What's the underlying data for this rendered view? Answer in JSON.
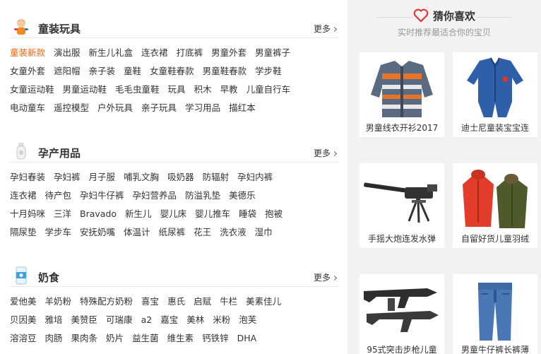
{
  "sections": [
    {
      "title": "童装玩具",
      "more": "更多",
      "rows": [
        [
          "童装新款",
          "演出服",
          "新生儿礼盒",
          "连衣裙",
          "打底裤",
          "男童外套",
          "男童裤子"
        ],
        [
          "女童外套",
          "遮阳帽",
          "亲子装",
          "童鞋",
          "女童鞋春款",
          "男童鞋春款",
          "学步鞋"
        ],
        [
          "女童运动鞋",
          "男童运动鞋",
          "毛毛虫童鞋",
          "玩具",
          "积木",
          "早教",
          "儿童自行车"
        ],
        [
          "电动童车",
          "遥控模型",
          "户外玩具",
          "亲子玩具",
          "学习用品",
          "描红本"
        ]
      ]
    },
    {
      "title": "孕产用品",
      "more": "更多",
      "rows": [
        [
          "孕妇春装",
          "孕妇裤",
          "月子服",
          "哺乳文胸",
          "吸奶器",
          "防辐射",
          "孕妇内裤"
        ],
        [
          "连衣裙",
          "待产包",
          "孕妇牛仔裤",
          "孕妇营养品",
          "防溢乳垫",
          "美德乐"
        ],
        [
          "十月妈咪",
          "三洋",
          "Bravado",
          "新生儿",
          "婴儿床",
          "婴儿推车",
          "睡袋",
          "抱被"
        ],
        [
          "隔尿垫",
          "学步车",
          "安抚奶嘴",
          "体温计",
          "纸尿裤",
          "花王",
          "洗衣液",
          "湿巾"
        ]
      ]
    },
    {
      "title": "奶食",
      "more": "更多",
      "rows": [
        [
          "爱他美",
          "羊奶粉",
          "特殊配方奶粉",
          "喜宝",
          "惠氏",
          "启赋",
          "牛栏",
          "美素佳儿"
        ],
        [
          "贝因美",
          "雅培",
          "美赞臣",
          "可瑞康",
          "a2",
          "嘉宝",
          "美林",
          "米粉",
          "泡芙"
        ],
        [
          "溶溶豆",
          "肉肠",
          "果肉条",
          "奶片",
          "益生菌",
          "维生素",
          "钙铁锌",
          "DHA"
        ]
      ]
    }
  ],
  "guess": {
    "title": "猜你喜欢",
    "subtitle": "实时推荐最适合你的宝贝",
    "items": [
      {
        "caption": "男童线衣开衫2017",
        "icon": "striped-cardigan"
      },
      {
        "caption": "迪士尼童装宝宝连",
        "icon": "denim-romper"
      },
      {
        "caption": "手摇大炮连发水弹",
        "icon": "toy-cannon"
      },
      {
        "caption": "自留好货儿童羽绒",
        "icon": "down-jackets"
      },
      {
        "caption": "95式突击步枪儿童",
        "icon": "toy-rifles"
      },
      {
        "caption": "男童牛仔裤长裤薄",
        "icon": "kids-jeans"
      }
    ]
  },
  "colors": {
    "hot_tag": "#e86a1a",
    "heart": "#e4393c",
    "panel_bg": "#f2f2f2"
  }
}
